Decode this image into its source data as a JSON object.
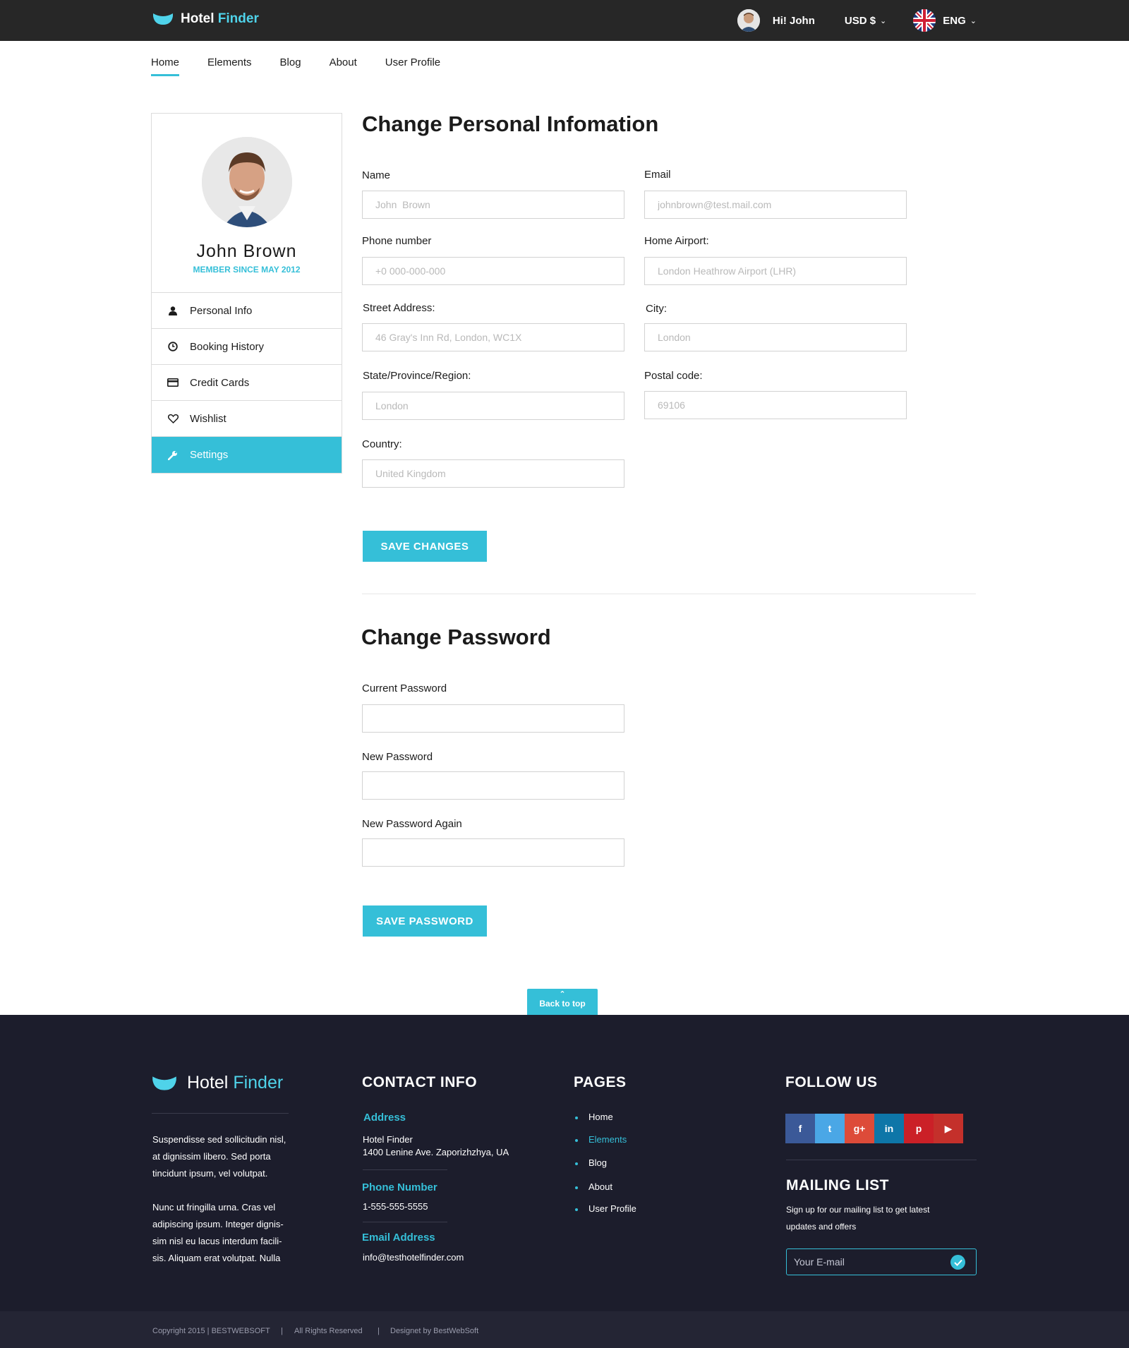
{
  "header": {
    "logo_word1": "Hotel",
    "logo_word2": "Finder",
    "greeting": "Hi! John",
    "currency": "USD  $",
    "language": "ENG"
  },
  "nav": {
    "items": [
      "Home",
      "Elements",
      "Blog",
      "About",
      "User Profile"
    ],
    "active": "Home"
  },
  "sidebar": {
    "name": "John  Brown",
    "member_since": "MEMBER SINCE MAY 2012",
    "items": [
      {
        "label": "Personal Info",
        "icon": "user-icon"
      },
      {
        "label": "Booking History",
        "icon": "clock-icon"
      },
      {
        "label": "Credit Cards",
        "icon": "credit-card-icon"
      },
      {
        "label": "Wishlist",
        "icon": "heart-icon"
      },
      {
        "label": "Settings",
        "icon": "wrench-icon",
        "active": true
      }
    ]
  },
  "personal": {
    "title_light": "Change ",
    "title_bold": "Personal Infomation",
    "fields": {
      "name": {
        "label": "Name",
        "placeholder": "John  Brown"
      },
      "email": {
        "label": "Email",
        "placeholder": "johnbrown@test.mail.com"
      },
      "phone": {
        "label": "Phone number",
        "placeholder": "+0 000-000-000"
      },
      "airport": {
        "label": "Home Airport:",
        "placeholder": "London Heathrow Airport (LHR)"
      },
      "street": {
        "label": "Street Address:",
        "placeholder": "46 Gray's Inn Rd, London, WC1X"
      },
      "city": {
        "label": "City:",
        "placeholder": "London"
      },
      "state": {
        "label": "State/Province/Region:",
        "placeholder": "London"
      },
      "postal": {
        "label": "Postal code:",
        "placeholder": "69106"
      },
      "country": {
        "label": "Country:",
        "placeholder": "United Kingdom"
      }
    },
    "save_label": "SAVE CHANGES"
  },
  "password": {
    "title_light": "Change ",
    "title_bold": "Password",
    "current_label": "Current Password",
    "new_label": "New Password",
    "again_label": "New Password Again",
    "save_label": "SAVE PASSWORD"
  },
  "back_to_top": "Back to top",
  "footer": {
    "logo_word1": "Hotel",
    "logo_word2": "Finder",
    "about_p1": [
      "Suspendisse sed sollicitudin nisl,",
      "at dignissim libero. Sed porta",
      "tincidunt ipsum, vel volutpat."
    ],
    "about_p2": [
      "Nunc ut fringilla urna. Cras vel",
      "adipiscing ipsum. Integer dignis-",
      "sim nisl eu lacus interdum facili-",
      "sis. Aliquam erat volutpat. Nulla"
    ],
    "contact": {
      "heading": "CONTACT INFO",
      "address_label": "Address",
      "address_line1": "Hotel Finder",
      "address_line2": "1400 Lenine Ave. Zaporizhzhya, UA",
      "phone_label": "Phone Number",
      "phone": "1-555-555-5555",
      "email_label": "Email Address",
      "email": "info@testhotelfinder.com"
    },
    "pages": {
      "heading": "PAGES",
      "items": [
        "Home",
        "Elements",
        "Blog",
        "About",
        "User Profile"
      ],
      "highlighted": "Elements"
    },
    "follow": {
      "heading": "FOLLOW US",
      "socials": [
        {
          "name": "facebook-icon",
          "glyph": "f",
          "color": "#3b5998"
        },
        {
          "name": "twitter-icon",
          "glyph": "t",
          "color": "#4aa7e6"
        },
        {
          "name": "google-plus-icon",
          "glyph": "g+",
          "color": "#dd4b39"
        },
        {
          "name": "linkedin-icon",
          "glyph": "in",
          "color": "#0e76a8"
        },
        {
          "name": "pinterest-icon",
          "glyph": "p",
          "color": "#cb2027"
        },
        {
          "name": "youtube-icon",
          "glyph": "▶",
          "color": "#c4302b"
        }
      ]
    },
    "mailing": {
      "heading": "MAILING LIST",
      "text1": "Sign up for our mailing list to get latest",
      "text2": "updates and offers",
      "placeholder": "Your E-mail"
    },
    "copyright": "Copyright   2015  | BESTWEBSOFT",
    "rights": "All Rights Reserved",
    "designed": "Designet by BestWebSoft"
  }
}
